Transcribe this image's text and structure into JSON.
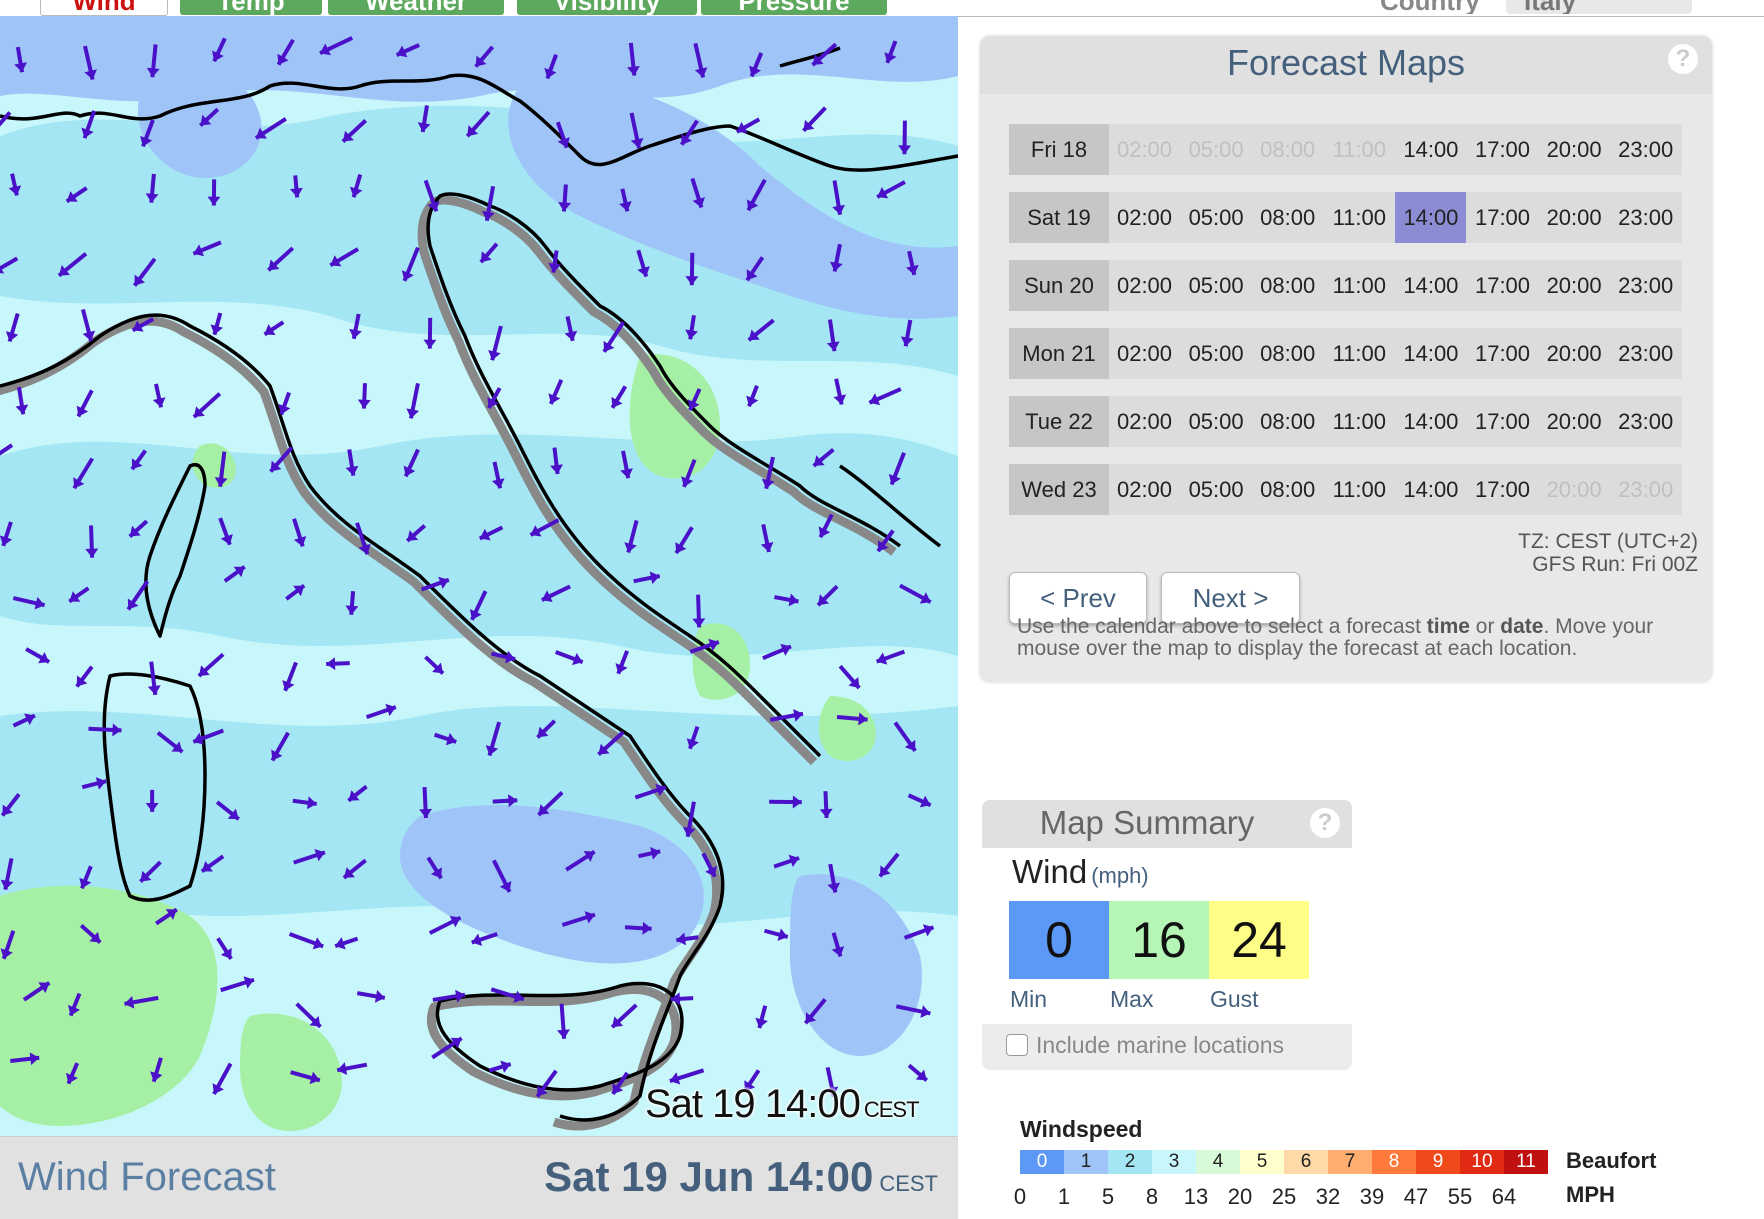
{
  "tabs": [
    {
      "label": "Wind",
      "active": true
    },
    {
      "label": "Temp",
      "active": false
    },
    {
      "label": "Weather",
      "active": false
    },
    {
      "label": "Visibility",
      "active": false
    },
    {
      "label": "Pressure",
      "active": false
    }
  ],
  "country": {
    "label": "Country",
    "value": "Italy"
  },
  "map": {
    "timestamp": "Sat 19 14:00",
    "timezone": "CEST",
    "colors": {
      "calm": "#c8f7fb",
      "light": "#a5e6f4",
      "moderate": "#9ec4f8",
      "breeze": "#a6f0a6",
      "arrow": "#4a11c8",
      "coast": "#000000"
    }
  },
  "footer": {
    "title": "Wind Forecast",
    "datetime": "Sat 19 Jun 14:00",
    "timezone": "CEST"
  },
  "forecast": {
    "title": "Forecast Maps",
    "help": "?",
    "days": [
      {
        "label": "Fri 18",
        "times": [
          "02:00",
          "05:00",
          "08:00",
          "11:00",
          "14:00",
          "17:00",
          "20:00",
          "23:00"
        ],
        "disabled": [
          0,
          1,
          2,
          3
        ],
        "selected": -1
      },
      {
        "label": "Sat 19",
        "times": [
          "02:00",
          "05:00",
          "08:00",
          "11:00",
          "14:00",
          "17:00",
          "20:00",
          "23:00"
        ],
        "disabled": [],
        "selected": 4
      },
      {
        "label": "Sun 20",
        "times": [
          "02:00",
          "05:00",
          "08:00",
          "11:00",
          "14:00",
          "17:00",
          "20:00",
          "23:00"
        ],
        "disabled": [],
        "selected": -1
      },
      {
        "label": "Mon 21",
        "times": [
          "02:00",
          "05:00",
          "08:00",
          "11:00",
          "14:00",
          "17:00",
          "20:00",
          "23:00"
        ],
        "disabled": [],
        "selected": -1
      },
      {
        "label": "Tue 22",
        "times": [
          "02:00",
          "05:00",
          "08:00",
          "11:00",
          "14:00",
          "17:00",
          "20:00",
          "23:00"
        ],
        "disabled": [],
        "selected": -1
      },
      {
        "label": "Wed 23",
        "times": [
          "02:00",
          "05:00",
          "08:00",
          "11:00",
          "14:00",
          "17:00",
          "20:00",
          "23:00"
        ],
        "disabled": [
          6,
          7
        ],
        "selected": -1
      }
    ],
    "prev_label": "< Prev",
    "next_label": "Next >",
    "tz_line": "TZ: CEST (UTC+2)",
    "run_line": "GFS Run: Fri 00Z",
    "instructions": {
      "part1": "Use the calendar above to select a forecast ",
      "bold1": "time",
      "part2": " or ",
      "bold2": "date",
      "part3": ". Move your mouse over the map to display the forecast at each location."
    }
  },
  "summary": {
    "title": "Map Summary",
    "help": "?",
    "metric": "Wind",
    "unit": "(mph)",
    "min": {
      "value": "0",
      "label": "Min",
      "color": "#5c99f7"
    },
    "max": {
      "value": "16",
      "label": "Max",
      "color": "#b5f5b5"
    },
    "gust": {
      "value": "24",
      "label": "Gust",
      "color": "#ffff88"
    },
    "marine_label": "Include marine locations",
    "marine_checked": false
  },
  "legend": {
    "title": "Windspeed",
    "beaufort_label": "Beaufort",
    "mph_label": "MPH",
    "beaufort": [
      "0",
      "1",
      "2",
      "3",
      "4",
      "5",
      "6",
      "7",
      "8",
      "9",
      "10",
      "11"
    ],
    "colors": [
      "#5c99f7",
      "#9ec4f8",
      "#a5e6f4",
      "#c8f7fb",
      "#d8fad8",
      "#ffffcc",
      "#ffd9a8",
      "#ffae70",
      "#ff7a3a",
      "#f04a1a",
      "#e02a12",
      "#c01010"
    ],
    "mph": [
      "0",
      "1",
      "5",
      "8",
      "13",
      "20",
      "25",
      "32",
      "39",
      "47",
      "55",
      "64"
    ]
  }
}
